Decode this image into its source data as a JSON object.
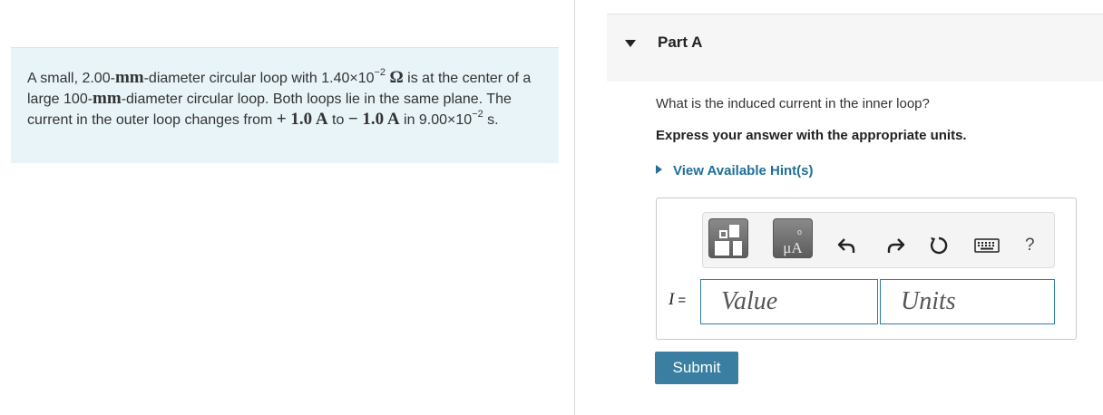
{
  "problem": {
    "s1": "A small, 2.00-",
    "unit_mm_1": "mm",
    "s2": "-diameter circular loop with 1.40×10",
    "exp1": "−2",
    "ohm": "Ω",
    "s3": " is at the center of a large 100-",
    "unit_mm_2": "mm",
    "s4": "-diameter circular loop. Both loops lie in the same plane. The current in the outer loop changes from ",
    "current_from": "+ 1.0 A",
    "s5": " to ",
    "current_to": "− 1.0 A",
    "s6": " in 9.00×10",
    "exp2": "−2",
    "sec": " s."
  },
  "part": {
    "title": "Part A"
  },
  "question": "What is the induced current in the inner loop?",
  "instruction": "Express your answer with the appropriate units.",
  "hint_label": "View Available Hint(s)",
  "toolbar": {
    "units_symbol": "μA",
    "units_ring": "o",
    "help": "?",
    "icons": [
      "templates-icon",
      "units-icon",
      "undo-icon",
      "redo-icon",
      "reset-icon",
      "keyboard-icon",
      "help-icon"
    ]
  },
  "answer": {
    "variable": "I",
    "equals": "=",
    "value_placeholder": "Value",
    "units_placeholder": "Units"
  },
  "submit_label": "Submit",
  "colors": {
    "problem_bg": "#e8f4f8",
    "link": "#1f6f96",
    "submit": "#3a7fa1",
    "field_border": "#2a7fa6"
  }
}
